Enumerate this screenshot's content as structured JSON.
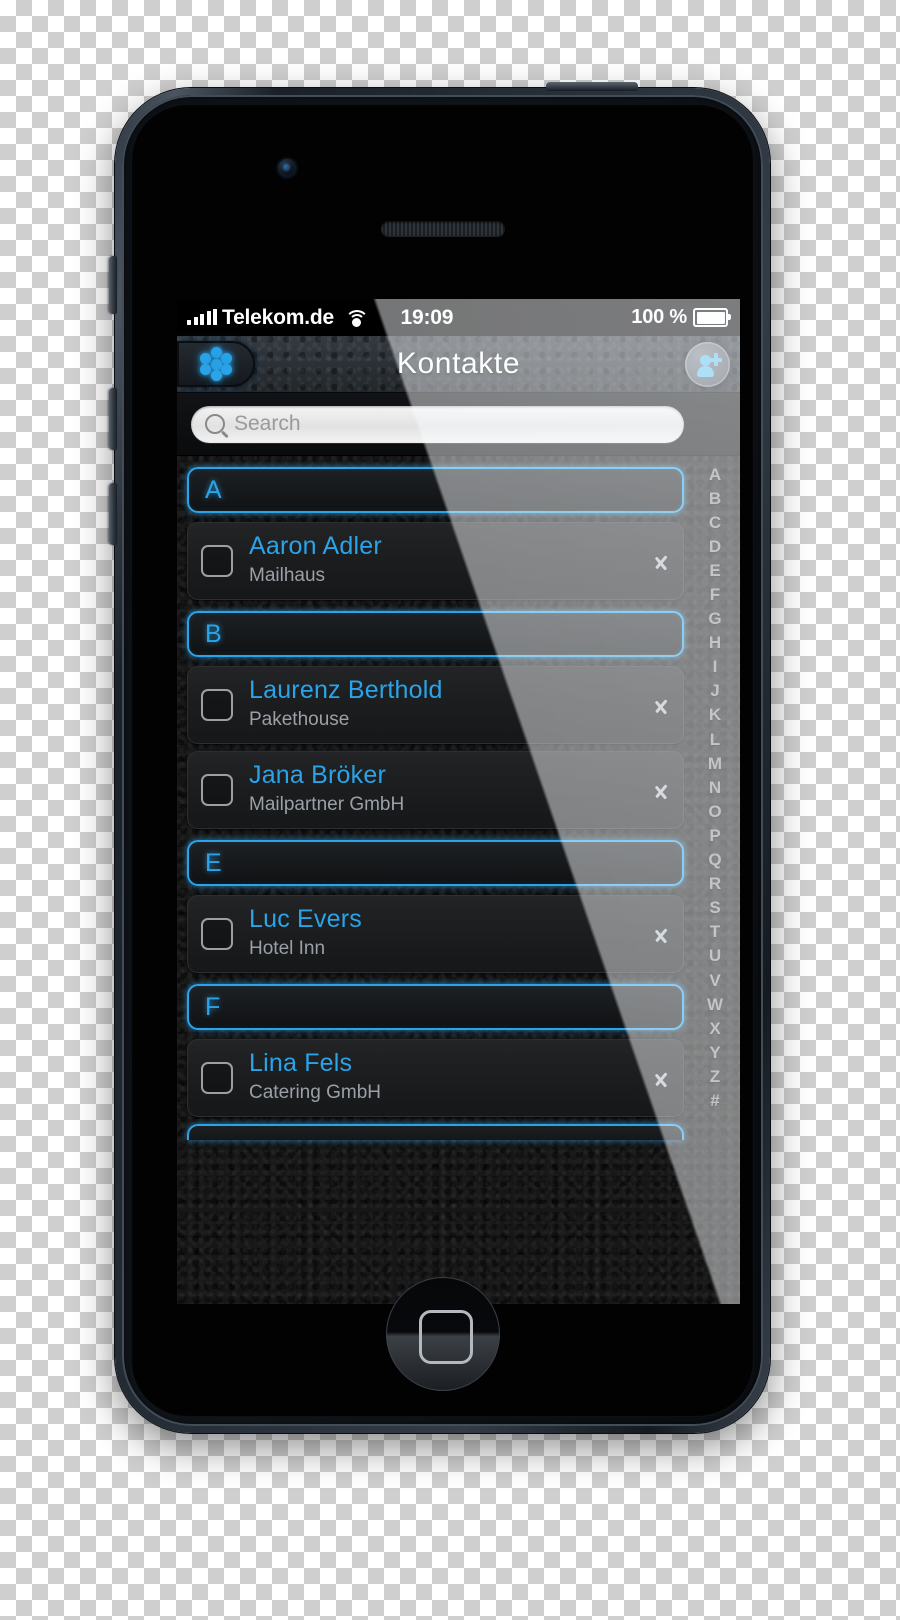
{
  "status_bar": {
    "signal_icon": "signal-bars-icon",
    "carrier": "Telekom.de",
    "wifi_icon": "wifi-icon",
    "time": "19:09",
    "battery_percent": "100 %",
    "battery_icon": "battery-full-icon"
  },
  "nav_bar": {
    "groups_button_icon": "flower-cluster-icon",
    "title": "Kontakte",
    "add_button_icon": "add-contact-icon"
  },
  "search": {
    "icon": "search-icon",
    "placeholder": "Search",
    "value": ""
  },
  "sections": [
    {
      "letter": "A",
      "contacts": [
        {
          "name": "Aaron Adler",
          "company": "Mailhaus",
          "checkbox_icon": "unchecked-box-icon",
          "disclosure_icon": "chevron-right-icon"
        }
      ]
    },
    {
      "letter": "B",
      "contacts": [
        {
          "name": "Laurenz Berthold",
          "company": "Pakethouse",
          "checkbox_icon": "unchecked-box-icon",
          "disclosure_icon": "chevron-right-icon"
        },
        {
          "name": "Jana Bröker",
          "company": "Mailpartner GmbH",
          "checkbox_icon": "unchecked-box-icon",
          "disclosure_icon": "chevron-right-icon"
        }
      ]
    },
    {
      "letter": "E",
      "contacts": [
        {
          "name": "Luc Evers",
          "company": "Hotel Inn",
          "checkbox_icon": "unchecked-box-icon",
          "disclosure_icon": "chevron-right-icon"
        }
      ]
    },
    {
      "letter": "F",
      "contacts": [
        {
          "name": "Lina Fels",
          "company": "Catering GmbH",
          "checkbox_icon": "unchecked-box-icon",
          "disclosure_icon": "chevron-right-icon"
        }
      ]
    }
  ],
  "alpha_index": [
    "A",
    "B",
    "C",
    "D",
    "E",
    "F",
    "G",
    "H",
    "I",
    "J",
    "K",
    "L",
    "M",
    "N",
    "O",
    "P",
    "Q",
    "R",
    "S",
    "T",
    "U",
    "V",
    "W",
    "X",
    "Y",
    "Z",
    "#"
  ],
  "hardware": {
    "camera_icon": "front-camera-icon",
    "speaker_icon": "earpiece-speaker-icon",
    "home_button_icon": "home-button-icon",
    "mute_switch_icon": "mute-switch-icon",
    "volume_up_icon": "volume-up-button-icon",
    "volume_down_icon": "volume-down-button-icon",
    "power_button_icon": "power-button-icon"
  },
  "colors": {
    "accent_blue": "#2aa3e8",
    "icon_blue": "#62c3f0",
    "row_bg": "#1b1d1f",
    "index_text": "#8e949a",
    "subtitle": "#9aa0a6"
  }
}
